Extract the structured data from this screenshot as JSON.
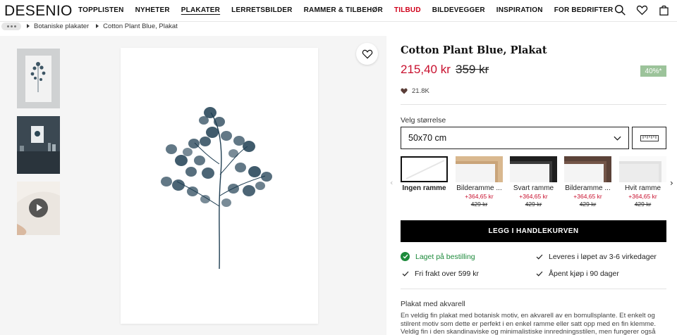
{
  "header": {
    "logo": "DESENIO",
    "nav": [
      {
        "label": "TOPPLISTEN",
        "style": "normal"
      },
      {
        "label": "NYHETER",
        "style": "normal"
      },
      {
        "label": "PLAKATER",
        "style": "active"
      },
      {
        "label": "LERRETSBILDER",
        "style": "normal"
      },
      {
        "label": "RAMMER & TILBEHØR",
        "style": "normal"
      },
      {
        "label": "TILBUD",
        "style": "sale"
      },
      {
        "label": "BILDEVEGGER",
        "style": "normal"
      },
      {
        "label": "INSPIRATION",
        "style": "normal"
      },
      {
        "label": "FOR BEDRIFTER",
        "style": "normal"
      }
    ],
    "icons": [
      "search-icon",
      "heart-icon",
      "bag-icon"
    ]
  },
  "breadcrumb": [
    "Botaniske plakater",
    "Cotton Plant Blue, Plakat"
  ],
  "product": {
    "title": "Cotton Plant Blue, Plakat",
    "price": "215,40 kr",
    "old_price": "359 kr",
    "discount": "40%*",
    "likes": "21.8K",
    "size_label": "Velg størrelse",
    "size_value": "50x70 cm",
    "cta": "LEGG I HANDLEKURVEN"
  },
  "frames": [
    {
      "label": "Ingen ramme",
      "price": "",
      "old_price": "",
      "selected": true,
      "color": "#ffffff"
    },
    {
      "label": "Bilderamme ...",
      "price": "+364,65 kr",
      "old_price": "429 kr",
      "selected": false,
      "color": "#d9b88f"
    },
    {
      "label": "Svart ramme",
      "price": "+364,65 kr",
      "old_price": "429 kr",
      "selected": false,
      "color": "#1e1e1e"
    },
    {
      "label": "Bilderamme ...",
      "price": "+364,65 kr",
      "old_price": "429 kr",
      "selected": false,
      "color": "#5b4238"
    },
    {
      "label": "Hvit ramme",
      "price": "+364,65 kr",
      "old_price": "429 kr",
      "selected": false,
      "color": "#f4f4f4"
    }
  ],
  "usps": {
    "in_stock": "Laget på bestilling",
    "delivery": "Leveres i løpet av 3-6 virkedager",
    "shipping": "Fri frakt over 599 kr",
    "returns": "Åpent kjøp i 90 dager"
  },
  "description": {
    "title": "Plakat med akvarell",
    "text_lines": [
      "En veldig fin plakat med botanisk motiv, en akvarell av en bomullsplante. Et enkelt og",
      "stilrent motiv som dette er perfekt i en enkel ramme eller satt opp med en fin klemme.",
      "Veldig fin i den skandinaviske og minimalistiske innredningsstilen, men fungerer også"
    ]
  },
  "colors": {
    "sale_red": "#c8102e",
    "badge_green": "#9cc39a",
    "stock_green": "#1d8a3b"
  }
}
